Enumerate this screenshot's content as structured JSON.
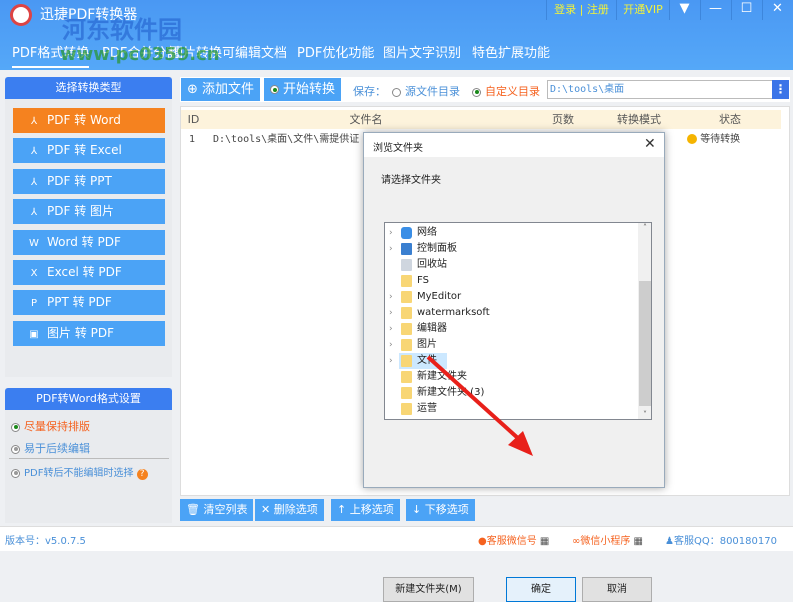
{
  "app": {
    "title": "迅捷PDF转换器",
    "watermark": "河东软件园",
    "watermark_url": "www.pc0359.cn"
  },
  "topbar": {
    "login": "登录",
    "sep": "|",
    "register": "注册",
    "vip": "开通VIP"
  },
  "tabs": [
    "PDF格式转换",
    "PDF合并分割",
    "图片转换可编辑文档",
    "PDF优化功能",
    "图片文字识别",
    "特色扩展功能"
  ],
  "sidebar": {
    "header": "选择转换类型",
    "items": [
      {
        "label": "PDF 转 Word",
        "icon": "pdf-icon"
      },
      {
        "label": "PDF 转 Excel",
        "icon": "pdf-icon"
      },
      {
        "label": "PDF 转 PPT",
        "icon": "pdf-icon"
      },
      {
        "label": "PDF 转 图片",
        "icon": "pdf-icon"
      },
      {
        "label": "Word 转 PDF",
        "icon": "word-icon"
      },
      {
        "label": "Excel 转 PDF",
        "icon": "excel-icon"
      },
      {
        "label": "PPT  转 PDF",
        "icon": "ppt-icon"
      },
      {
        "label": "图片 转 PDF",
        "icon": "image-icon"
      }
    ],
    "settings_header": "PDF转Word格式设置",
    "options": [
      "尽量保持排版",
      "易于后续编辑",
      "PDF转后不能编辑时选择"
    ]
  },
  "toolbar": {
    "add_file": "添加文件",
    "start": "开始转换",
    "save_label": "保存：",
    "opt_source": "源文件目录",
    "opt_custom": "自定义目录",
    "path": "D:\\tools\\桌面"
  },
  "table": {
    "headers": [
      "ID",
      "文件名",
      "页数",
      "转换模式",
      "状态"
    ],
    "rows": [
      {
        "id": "1",
        "name": "D:\\tools\\桌面\\文件\\需提供证",
        "pages": "",
        "mode": "",
        "status": "等待转换"
      }
    ]
  },
  "bottom": {
    "clear": "清空列表",
    "delete": "删除选项",
    "up": "上移选项",
    "down": "下移选项"
  },
  "status": {
    "version": "版本号：v5.0.7.5",
    "wechat": "客服微信号",
    "miniapp": "微信小程序",
    "qq": "客服QQ：800180170"
  },
  "dialog": {
    "title": "浏览文件夹",
    "prompt": "请选择文件夹",
    "tree": [
      {
        "label": "网络",
        "chev": true,
        "icon": "network"
      },
      {
        "label": "控制面板",
        "chev": true,
        "icon": "control"
      },
      {
        "label": "回收站",
        "chev": false,
        "icon": "recycle"
      },
      {
        "label": "FS",
        "chev": false,
        "icon": "folder"
      },
      {
        "label": "MyEditor",
        "chev": true,
        "icon": "folder"
      },
      {
        "label": "watermarksoft",
        "chev": true,
        "icon": "folder"
      },
      {
        "label": "编辑器",
        "chev": true,
        "icon": "folder"
      },
      {
        "label": "图片",
        "chev": true,
        "icon": "folder"
      },
      {
        "label": "文件",
        "chev": true,
        "icon": "folder",
        "selected": true
      },
      {
        "label": "新建文件夹",
        "chev": false,
        "icon": "folder"
      },
      {
        "label": "新建文件夹 (3)",
        "chev": false,
        "icon": "folder"
      },
      {
        "label": "运营",
        "chev": false,
        "icon": "folder"
      }
    ],
    "new_folder": "新建文件夹(M)",
    "ok": "确定",
    "cancel": "取消"
  }
}
